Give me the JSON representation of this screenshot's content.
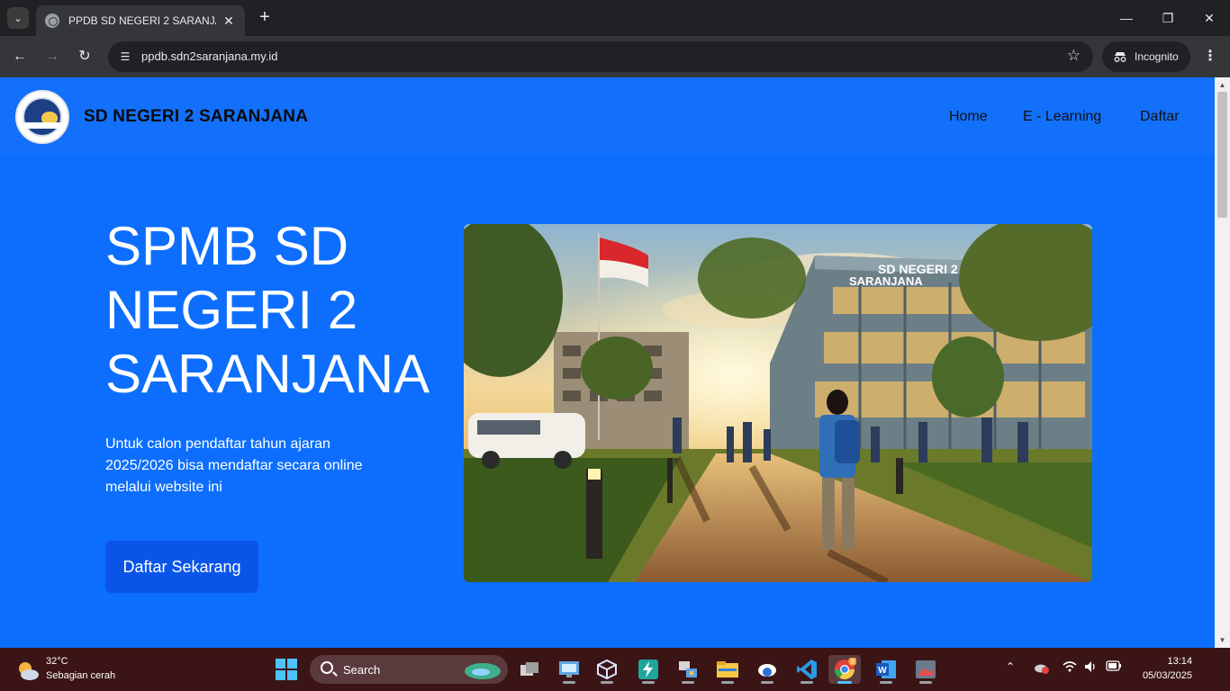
{
  "browser": {
    "tab_title": "PPDB SD NEGERI 2 SARANJANA",
    "url": "ppdb.sdn2saranjana.my.id",
    "incognito_label": "Incognito"
  },
  "site": {
    "brand": "SD NEGERI 2 SARANJANA",
    "nav": [
      "Home",
      "E - Learning",
      "Daftar"
    ],
    "hero": {
      "title_lines": [
        "SPMB SD",
        "NEGERI 2",
        "SARANJANA"
      ],
      "description": "Untuk calon pendaftar tahun ajaran 2025/2026 bisa mendaftar secara online melalui website ini",
      "cta": "Daftar Sekarang",
      "image_sign": [
        "SD NEGERI 2",
        "SARANJANA"
      ]
    },
    "colors": {
      "primary": "#0d6efd",
      "navbar": "#1370fa",
      "cta": "#0a55e8"
    }
  },
  "taskbar": {
    "weather_temp": "32°C",
    "weather_desc": "Sebagian cerah",
    "search_label": "Search",
    "time": "13:14",
    "date": "05/03/2025",
    "chrome_badge": "8"
  }
}
